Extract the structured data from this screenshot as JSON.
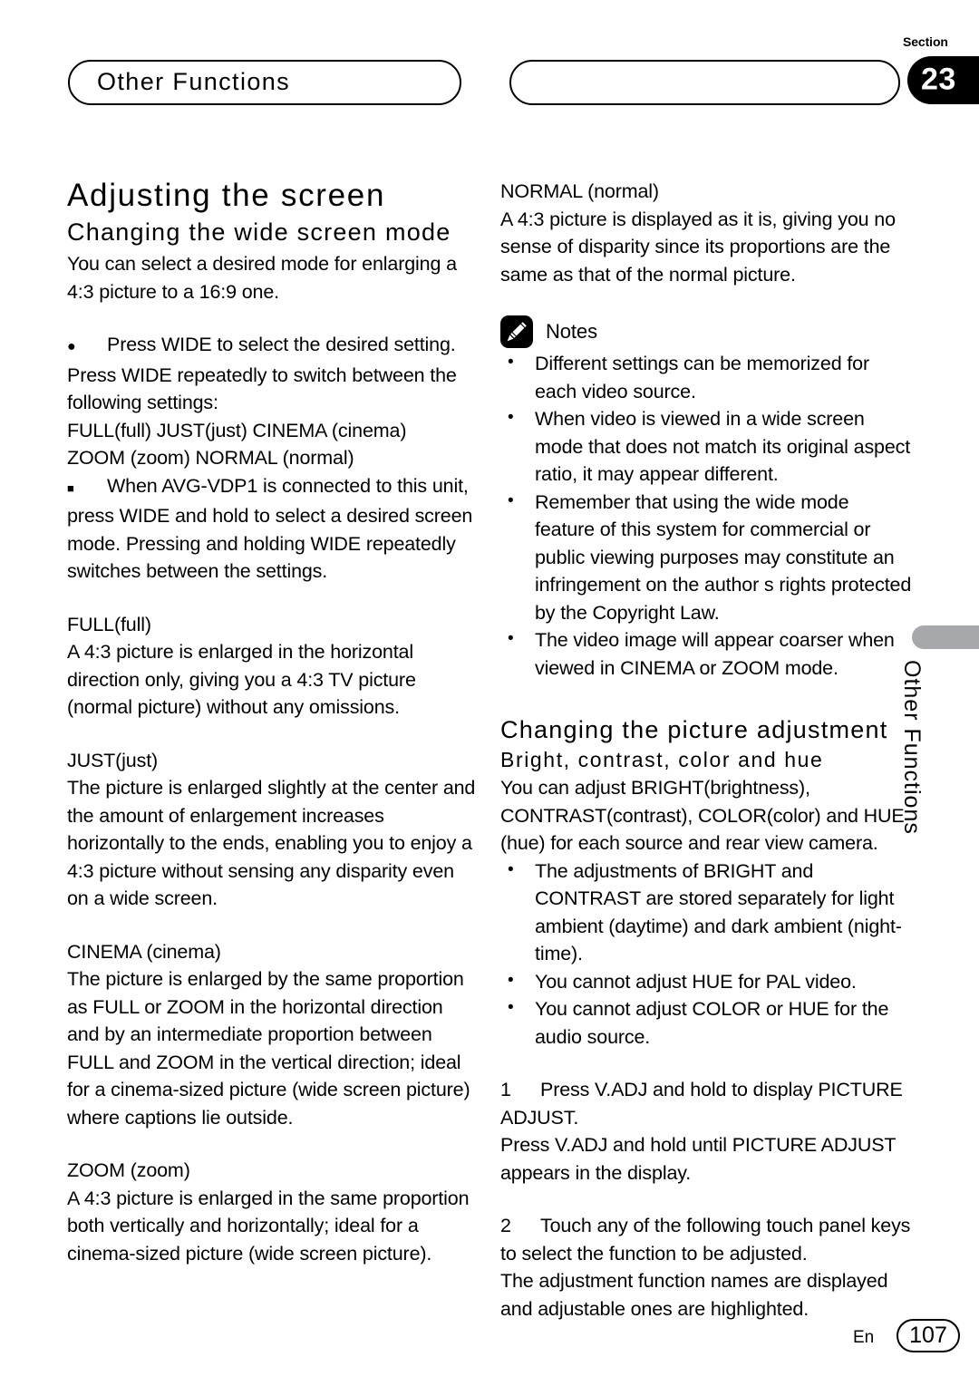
{
  "header": {
    "chapter_title": "Other Functions",
    "section_word": "Section",
    "section_number": "23"
  },
  "side_tab": {
    "label": "Other Functions"
  },
  "left_column": {
    "h1": "Adjusting the screen",
    "h2": "Changing the wide screen mode",
    "intro": "You can select a desired mode for enlarging a 4:3 picture to a 16:9 one.",
    "bullet_round": "Press WIDE to select the desired setting.",
    "bullet_round_body": "Press WIDE repeatedly to switch between the following settings:",
    "settings_line1": "FULL(full)    JUST(just)    CINEMA (cinema)",
    "settings_line2": "ZOOM (zoom)   NORMAL (normal)",
    "bullet_square": "When AVG-VDP1 is connected to this unit, press WIDE and hold to select a desired screen mode. Pressing and holding WIDE repeatedly switches between the settings.",
    "terms": [
      {
        "name": "FULL(full)",
        "text": "A 4:3 picture is enlarged in the horizontal direction only, giving you a 4:3 TV picture (normal picture) without any omissions."
      },
      {
        "name": "JUST(just)",
        "text": "The picture is enlarged slightly at the center and the amount of enlargement increases horizontally to the ends, enabling you to enjoy a 4:3 picture without sensing any disparity even on a wide screen."
      },
      {
        "name": "CINEMA (cinema)",
        "text": "The picture is enlarged by the same proportion as FULL or ZOOM in the horizontal direction and by an intermediate proportion between FULL and ZOOM in the vertical direction; ideal for a cinema-sized picture (wide screen picture) where captions lie outside."
      },
      {
        "name": "ZOOM (zoom)",
        "text": "A 4:3 picture is enlarged in the same proportion both vertically and horizontally; ideal for a cinema-sized picture (wide screen picture)."
      }
    ]
  },
  "right_column": {
    "normal_term": "NORMAL (normal)",
    "normal_text": "A 4:3 picture is displayed as it is, giving you no sense of disparity since its proportions are the same as that of the normal picture.",
    "notes_label": "Notes",
    "notes": [
      "Different settings can be memorized for each video source.",
      "When video is viewed in a wide screen mode that does not match its original aspect ratio, it may appear different.",
      "Remember that using the wide mode feature of this system for commercial or public viewing purposes may constitute an infringement on the author s rights protected by the Copyright Law.",
      "The video image will appear coarser when viewed in CINEMA or ZOOM mode."
    ],
    "h2": "Changing the picture adjustment",
    "h3": "Bright, contrast, color and hue",
    "intro": "You can adjust BRIGHT(brightness), CONTRAST(contrast), COLOR(color) and HUE (hue) for each source and rear view camera.",
    "adjust_notes": [
      "The adjustments of BRIGHT and CONTRAST are stored separately for light ambient (daytime) and dark ambient (night-time).",
      "You cannot adjust HUE for PAL video.",
      "You cannot adjust COLOR or HUE for the audio source."
    ],
    "steps": [
      {
        "number": "1",
        "title": "Press V.ADJ and hold to display PICTURE ADJUST.",
        "body": "Press V.ADJ and hold until  PICTURE ADJUST appears in the display."
      },
      {
        "number": "2",
        "title": "Touch any of the following touch panel keys to select the function to be adjusted.",
        "body": "The adjustment function names are displayed and adjustable ones are highlighted."
      }
    ]
  },
  "footer": {
    "language": "En",
    "page_number": "107"
  }
}
